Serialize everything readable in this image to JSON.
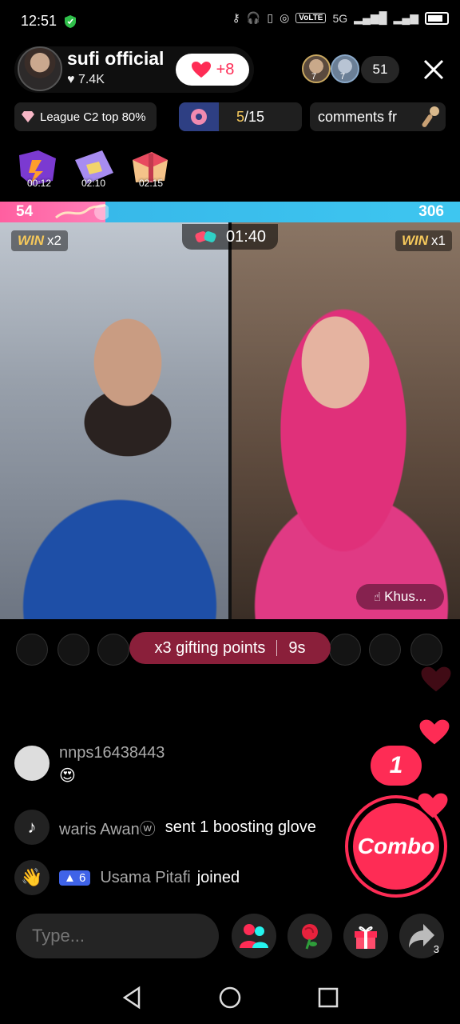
{
  "status": {
    "time": "12:51",
    "volte": "VoLTE",
    "network": "5G"
  },
  "host": {
    "name": "sufi official",
    "likes": "7.4K",
    "follow_count": "+8"
  },
  "viewers": {
    "count": "51",
    "levels": [
      "7",
      "7"
    ]
  },
  "pills": {
    "league": "League C2 top 80%",
    "rank_current": "5",
    "rank_total": "/15",
    "comments": "comments fr"
  },
  "boxes": [
    {
      "timer": "00:12"
    },
    {
      "timer": "02:10"
    },
    {
      "timer": "02:15"
    }
  ],
  "battle": {
    "left_score": "54",
    "right_score": "306",
    "timer": "01:40",
    "left_win": "x2",
    "right_win": "x1",
    "win_label": "WIN",
    "right_host": "Khus..."
  },
  "gifting": {
    "text": "x3 gifting points",
    "countdown": "9s"
  },
  "comments": [
    {
      "name": "nnps16438443",
      "text": "😍"
    },
    {
      "name": "waris Awanⓦ",
      "text": "sent 1 boosting glove"
    },
    {
      "level": "6",
      "name": "Usama Pitafi",
      "text": "joined"
    }
  ],
  "combo": {
    "count": "1",
    "label": "Combo"
  },
  "input": {
    "placeholder": "Type..."
  },
  "toolbar": {
    "share_count": "3"
  },
  "colors": {
    "accent": "#fe2c55",
    "battle_left": "#ff6fa8",
    "battle_right": "#3ec6f0"
  }
}
